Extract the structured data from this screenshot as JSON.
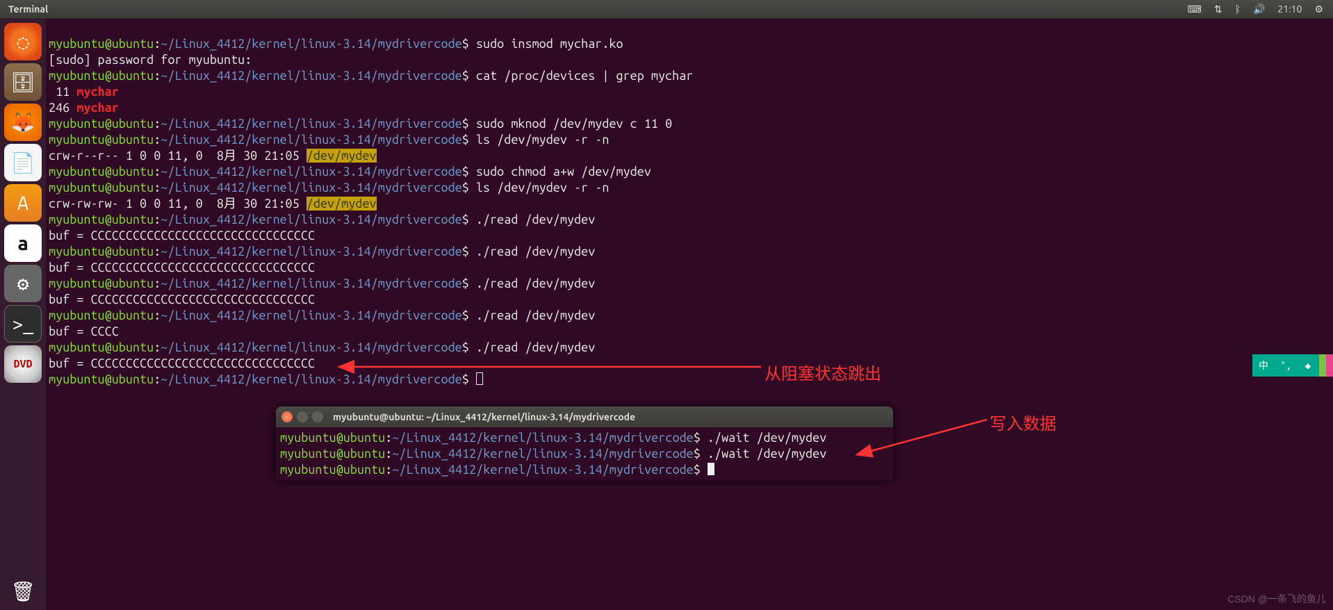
{
  "top_panel": {
    "app_name": "Terminal",
    "time": "21:10"
  },
  "terminal_main": {
    "prompt_user": "myubuntu@ubuntu",
    "prompt_path": "~/Linux_4412/kernel/linux-3.14/mydrivercode",
    "lines": {
      "cmd1": "sudo insmod mychar.ko",
      "sudo_prompt": "[sudo] password for myubuntu:",
      "cmd2": "cat /proc/devices | grep mychar",
      "dev11_num": " 11 ",
      "dev11_name": "mychar",
      "dev246_num": "246 ",
      "dev246_name": "mychar",
      "cmd3": "sudo mknod /dev/mydev c 11 0",
      "cmd4": "ls /dev/mydev -r -n",
      "ls1_pre": "crw-r--r-- 1 0 0 11, 0  8月 30 21:05 ",
      "ls1_hl": "/dev/mydev",
      "cmd5": "sudo chmod a+w /dev/mydev",
      "cmd6": "ls /dev/mydev -r -n",
      "ls2_pre": "crw-rw-rw- 1 0 0 11, 0  8月 30 21:05 ",
      "ls2_hl": "/dev/mydev",
      "cmd7": "./read /dev/mydev",
      "buf1": "buf = CCCCCCCCCCCCCCCCCCCCCCCCCCCCCCCC",
      "cmd8": "./read /dev/mydev",
      "buf2": "buf = CCCCCCCCCCCCCCCCCCCCCCCCCCCCCCCC",
      "cmd9": "./read /dev/mydev",
      "buf3": "buf = CCCCCCCCCCCCCCCCCCCCCCCCCCCCCCCC",
      "cmd10": "./read /dev/mydev",
      "buf4": "buf = CCCC",
      "cmd11": "./read /dev/mydev",
      "buf5": "buf = CCCCCCCCCCCCCCCCCCCCCCCCCCCCCCCC"
    }
  },
  "terminal_second": {
    "title": "myubuntu@ubuntu: ~/Linux_4412/kernel/linux-3.14/mydrivercode",
    "prompt_user": "myubuntu@ubuntu",
    "prompt_path": "~/Linux_4412/kernel/linux-3.14/mydrivercode",
    "cmd1": "./wait /dev/mydev",
    "cmd2": "./wait /dev/mydev"
  },
  "annotations": {
    "a1": "从阻塞状态跳出",
    "a2": "写入数据"
  },
  "ime": {
    "lang": "中",
    "punct": "°,",
    "mode": "◆"
  },
  "watermark": "CSDN @一条飞的鱼儿"
}
